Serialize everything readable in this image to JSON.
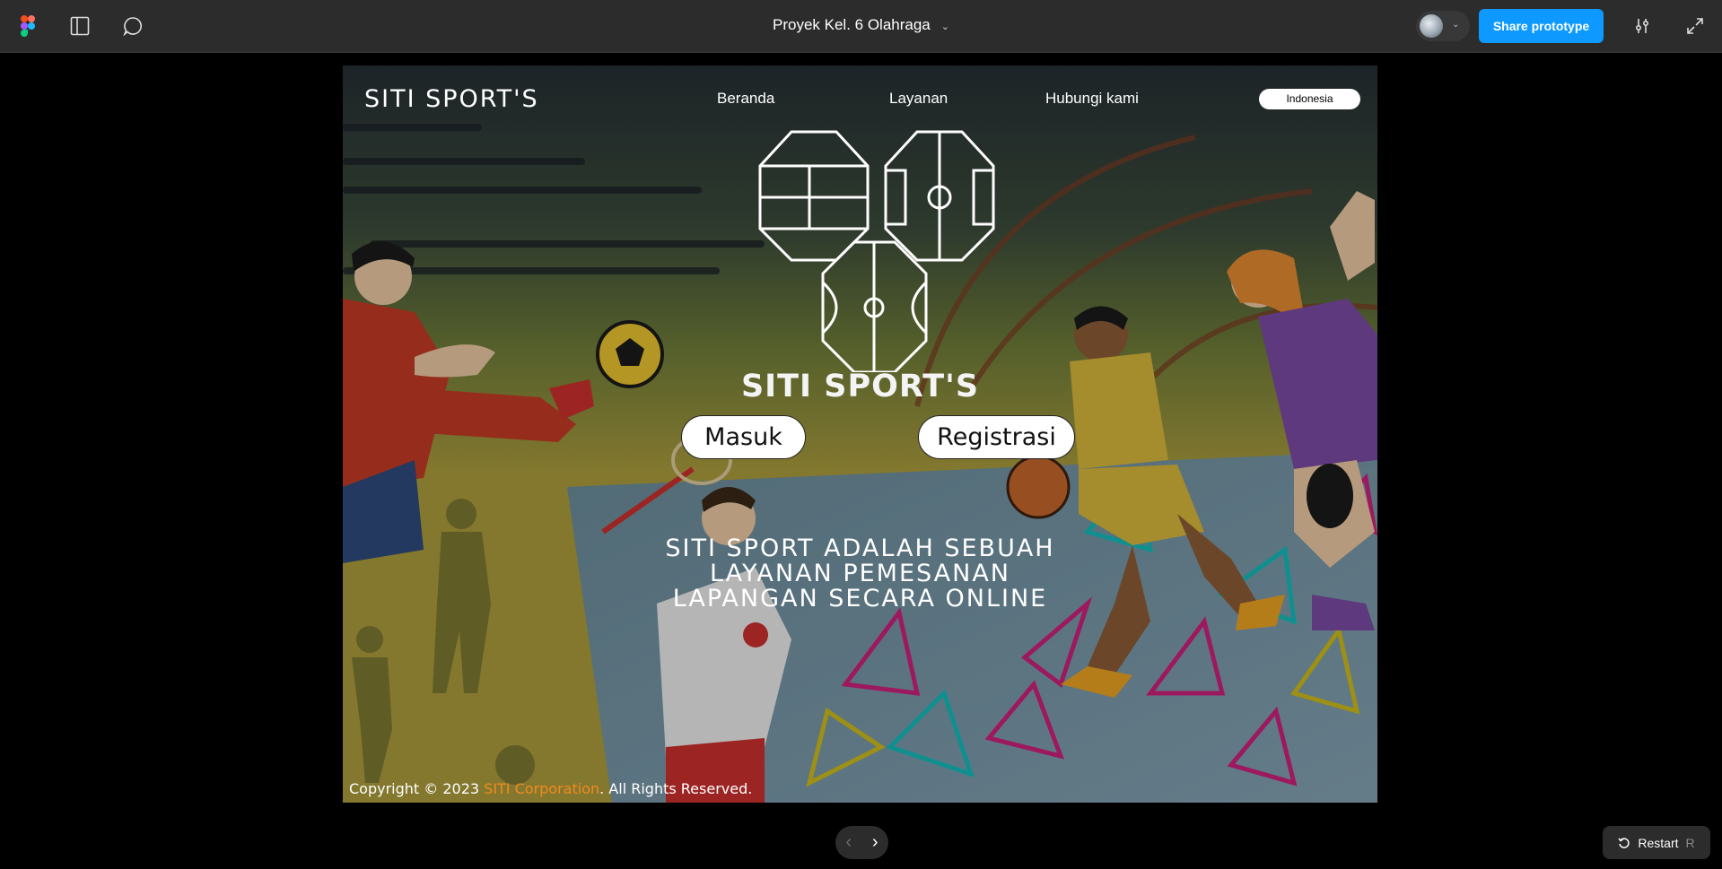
{
  "toolbar": {
    "title": "Proyek Kel. 6 Olahraga",
    "share_label": "Share prototype"
  },
  "site": {
    "brand": "SITI SPORT'S",
    "nav": [
      "Beranda",
      "Layanan",
      "Hubungi kami"
    ],
    "language": "Indonesia",
    "logo_text": "SITI SPORT'S",
    "buttons": {
      "login": "Masuk",
      "register": "Registrasi"
    },
    "tagline": [
      "SITI SPORT ADALAH SEBUAH",
      "LAYANAN PEMESANAN",
      "LAPANGAN SECARA ONLINE"
    ],
    "copyright_prefix": "Copyright  © 2023 ",
    "copyright_company": "SITI Corporation",
    "copyright_suffix": ". All Rights Reserved."
  },
  "controls": {
    "prev": "‹",
    "next": "›",
    "restart_label": "Restart",
    "restart_key": "R"
  },
  "colors": {
    "share_button": "#0d99ff",
    "toolbar_bg": "#2c2c2c",
    "corporation_text": "#f28b1e"
  }
}
